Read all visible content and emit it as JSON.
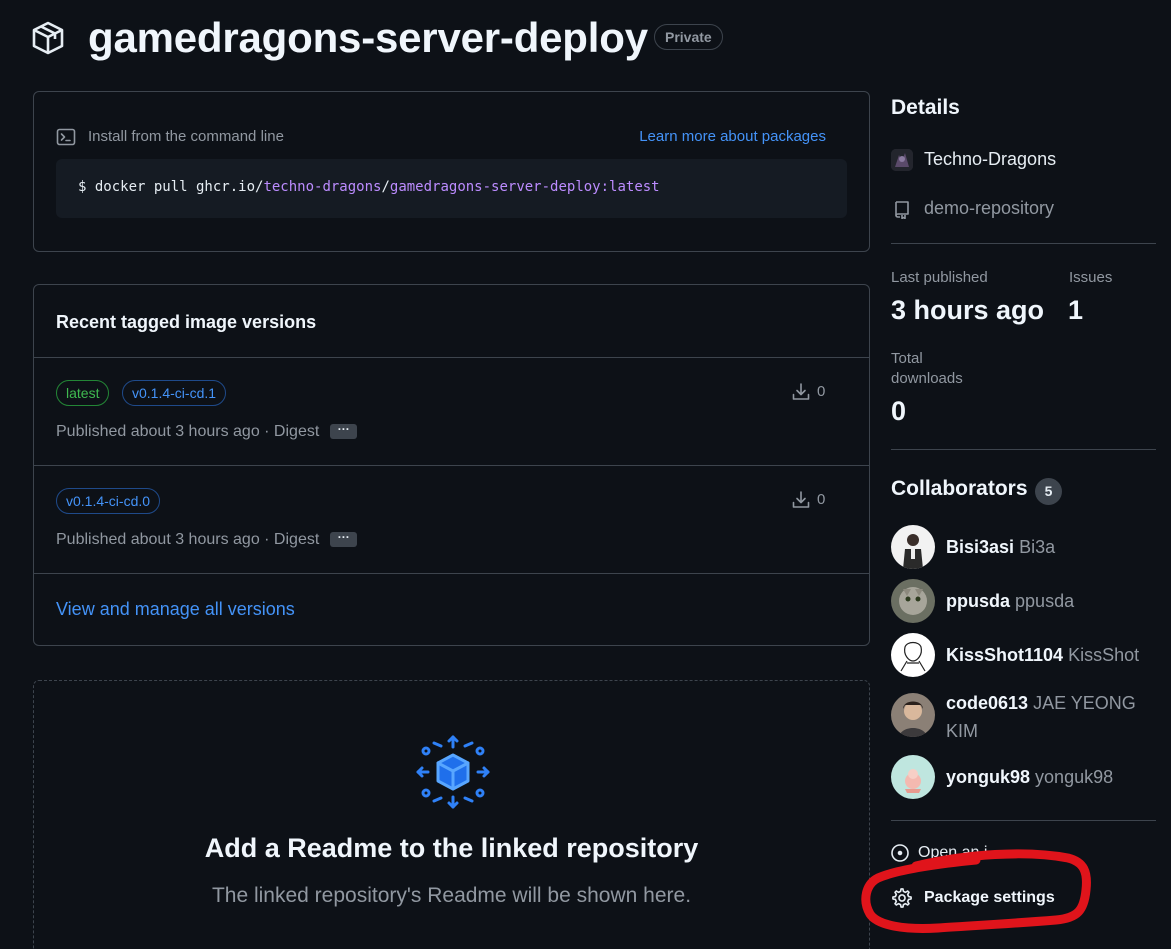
{
  "header": {
    "package_name": "gamedragons-server-deploy",
    "visibility_badge": "Private"
  },
  "install": {
    "label": "Install from the command line",
    "learn_more_link": "Learn more about packages",
    "command": {
      "prefix": "$ docker pull ghcr.io/",
      "owner": "techno-dragons",
      "slash": "/",
      "image": "gamedragons-server-deploy:latest"
    }
  },
  "versions": {
    "title": "Recent tagged image versions",
    "items": [
      {
        "tags": [
          "latest",
          "v0.1.4-ci-cd.1"
        ],
        "published": "Published about 3 hours ago · Digest",
        "digest_button": "···",
        "downloads": "0"
      },
      {
        "tags": [
          "v0.1.4-ci-cd.0"
        ],
        "published": "Published about 3 hours ago · Digest",
        "digest_button": "···",
        "downloads": "0"
      }
    ],
    "view_all_link": "View and manage all versions"
  },
  "readme": {
    "title": "Add a Readme to the linked repository",
    "subtitle": "The linked repository's Readme will be shown here."
  },
  "sidebar": {
    "details_heading": "Details",
    "org_name": "Techno-Dragons",
    "repo_name": "demo-repository",
    "last_published_label": "Last published",
    "last_published_value": "3 hours ago",
    "issues_label": "Issues",
    "issues_value": "1",
    "total_downloads_label_1": "Total",
    "total_downloads_label_2": "downloads",
    "total_downloads_value": "0",
    "collaborators_heading": "Collaborators",
    "collaborators_count": "5",
    "collaborators": [
      {
        "login": "Bisi3asi",
        "name": "Bi3a"
      },
      {
        "login": "ppusda",
        "name": "ppusda"
      },
      {
        "login": "KissShot1104",
        "name": "KissShot"
      },
      {
        "login": "code0613",
        "name": "JAE YEONG KIM"
      },
      {
        "login": "yonguk98",
        "name": "yonguk98"
      }
    ],
    "open_issue_label": "Open an i",
    "package_settings_label": "Package settings"
  },
  "colors": {
    "background": "#0d1117",
    "border": "#3d444d",
    "link": "#4493f8",
    "muted": "#9198a1",
    "annotation": "#e0141b",
    "tag_green": "#3fb950"
  }
}
